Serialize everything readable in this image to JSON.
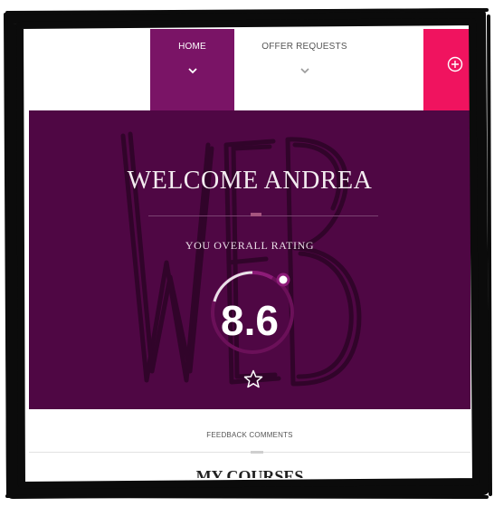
{
  "nav": {
    "tabs": [
      {
        "label": "HOME",
        "active": true
      },
      {
        "label": "OFFER REQUESTS",
        "active": false
      }
    ],
    "add_icon": "plus-circle-icon",
    "accent_color": "#f0135f",
    "active_color": "#7a1466"
  },
  "hero": {
    "title": "WELCOME ANDREA",
    "subtitle": "YOU OVERALL RATING",
    "rating": "8.6",
    "rating_icon": "star-outline-icon",
    "background_color": "#4f0744",
    "watermark_icon": "web-sketch-watermark"
  },
  "footer": {
    "feedback_label": "FEEDBACK COMMENTS",
    "courses_title": "MY COURSES"
  }
}
